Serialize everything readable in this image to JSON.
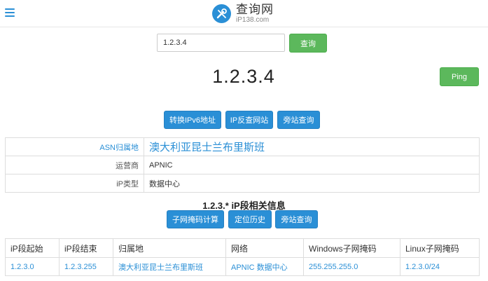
{
  "header": {
    "logo_main": "查询网",
    "logo_sub": "iP138.com"
  },
  "search": {
    "value": "1.2.3.4",
    "button": "查询"
  },
  "result": {
    "ip": "1.2.3.4",
    "ping_button": "Ping",
    "buttons": [
      "转换IPv6地址",
      "IP反查网站",
      "旁站查询"
    ]
  },
  "info": {
    "rows": [
      {
        "label": "ASN归属地",
        "value": "澳大利亚昆士兰布里斯班"
      },
      {
        "label": "运营商",
        "value": "APNIC"
      },
      {
        "label": "iP类型",
        "value": "数据中心"
      }
    ]
  },
  "range": {
    "title": "1.2.3.* iP段相关信息",
    "buttons": [
      "子网掩码计算",
      "定位历史",
      "旁站查询"
    ],
    "headers": [
      "iP段起始",
      "iP段结束",
      "归属地",
      "网络",
      "Windows子网掩码",
      "Linux子网掩码"
    ],
    "row": [
      "1.2.3.0",
      "1.2.3.255",
      "澳大利亚昆士兰布里斯班",
      "APNIC 数据中心",
      "255.255.255.0",
      "1.2.3.0/24"
    ]
  }
}
